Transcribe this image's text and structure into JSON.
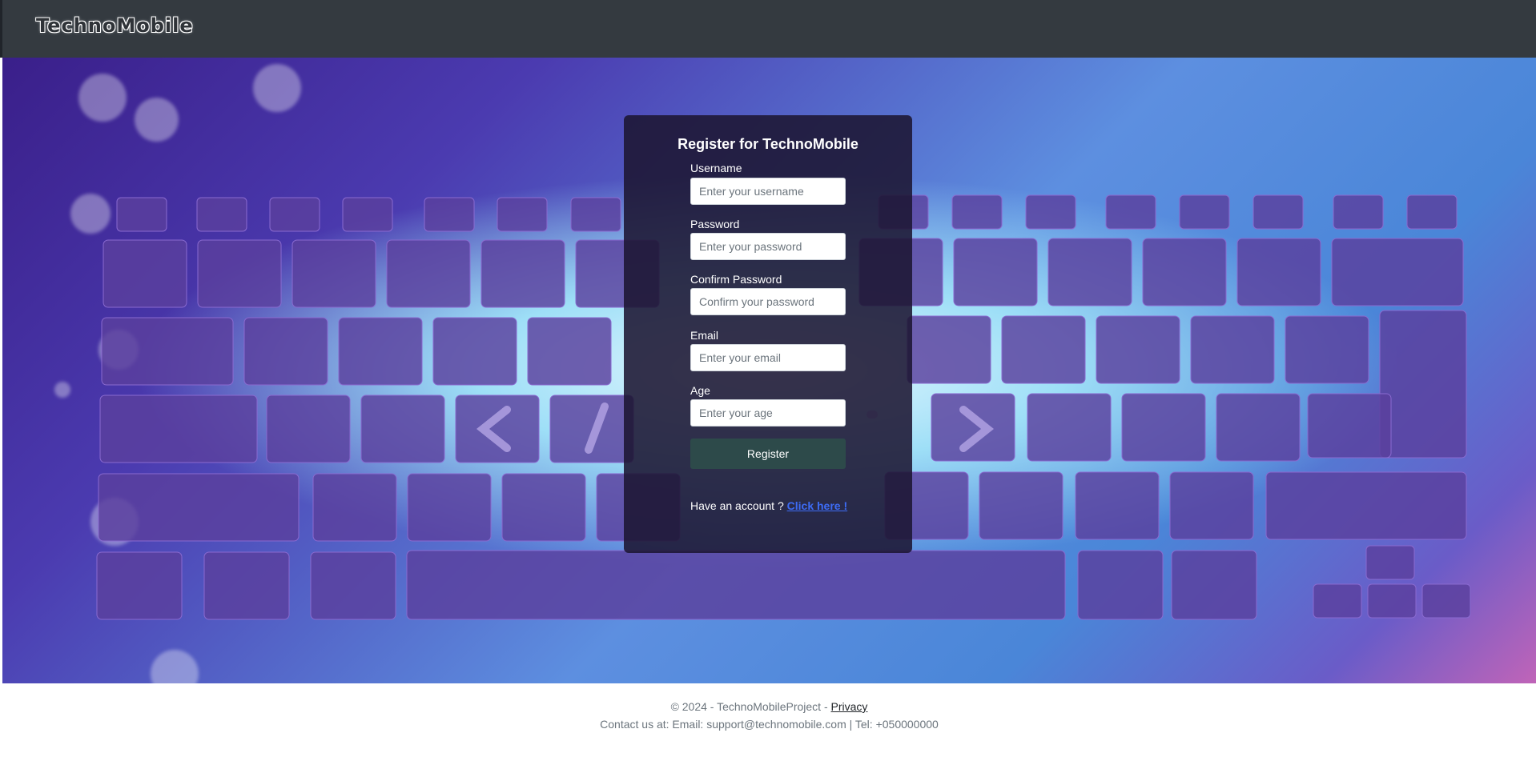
{
  "nav": {
    "brand": "TechnoMobile"
  },
  "form": {
    "title": "Register for TechnoMobile",
    "fields": [
      {
        "label": "Username",
        "placeholder": "Enter your username"
      },
      {
        "label": "Password",
        "placeholder": "Enter your password"
      },
      {
        "label": "Confirm Password",
        "placeholder": "Confirm your password"
      },
      {
        "label": "Email",
        "placeholder": "Enter your email"
      },
      {
        "label": "Age",
        "placeholder": "Enter your age"
      }
    ],
    "submit_label": "Register",
    "have_account_text": "Have an account ?",
    "login_link": "Click here !"
  },
  "footer": {
    "copyright": "© 2024 - TechnoMobileProject -",
    "privacy_link": "Privacy",
    "contact": "Contact us at: Email: support@technomobile.com | Tel: +050000000"
  },
  "colors": {
    "navbar": "#343a40",
    "card_background": "#1c1632",
    "button": "#2d4a4a",
    "link": "#3d6cf5"
  }
}
